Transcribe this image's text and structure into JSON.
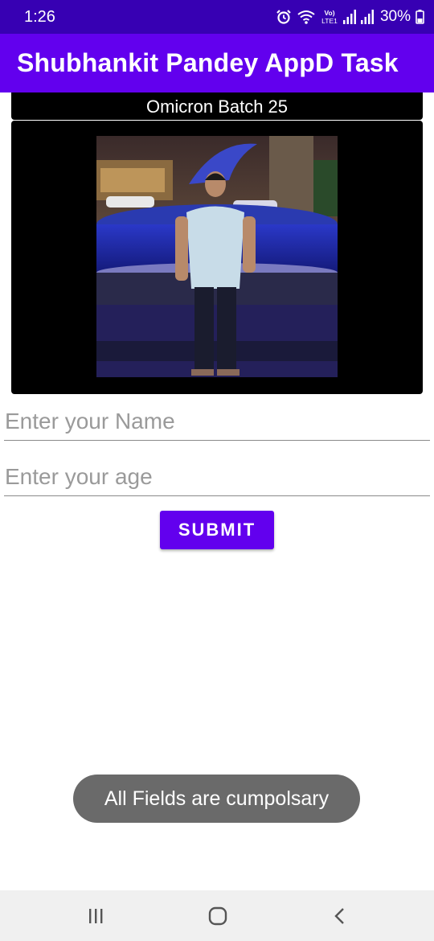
{
  "status_bar": {
    "time": "1:26",
    "battery": "30%",
    "icons": [
      "alarm-icon",
      "wifi-icon",
      "volte-icon",
      "signal-icon",
      "signal-icon",
      "battery-icon"
    ],
    "volte_label": "Vo)",
    "lte_label": "LTE1"
  },
  "app_bar": {
    "title": "Shubhankit Pandey AppD Task",
    "color": "#6200ee",
    "status_color": "#3700b3"
  },
  "banner": {
    "text": "Omicron Batch 25"
  },
  "photo": {
    "alt": "profile-photo"
  },
  "form": {
    "name_placeholder": "Enter your Name",
    "age_placeholder": "Enter your age",
    "submit_label": "SUBMIT"
  },
  "toast": {
    "message": "All Fields are cumpolsary"
  },
  "nav_bar": {
    "icons": [
      "recent-apps-icon",
      "home-icon",
      "back-icon"
    ]
  }
}
